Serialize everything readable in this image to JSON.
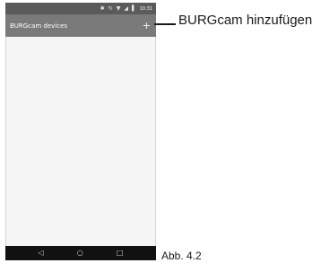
{
  "status_bar": {
    "time": "10:31",
    "icons": [
      "bluetooth-icon",
      "sync-icon",
      "wifi-icon",
      "signal-icon",
      "battery-icon"
    ]
  },
  "app_bar": {
    "title": "BURGcam devices",
    "add_label": "+"
  },
  "nav_bar": {
    "icons": [
      "back-icon",
      "home-icon",
      "recents-icon"
    ]
  },
  "annotation": {
    "callout": "BURGcam hinzufügen",
    "figure": "Abb. 4.2"
  },
  "colors": {
    "status_bar": "#5b5b5b",
    "app_bar": "#7a7a7a",
    "nav_bar": "#111111",
    "content_bg": "#f5f5f5"
  }
}
